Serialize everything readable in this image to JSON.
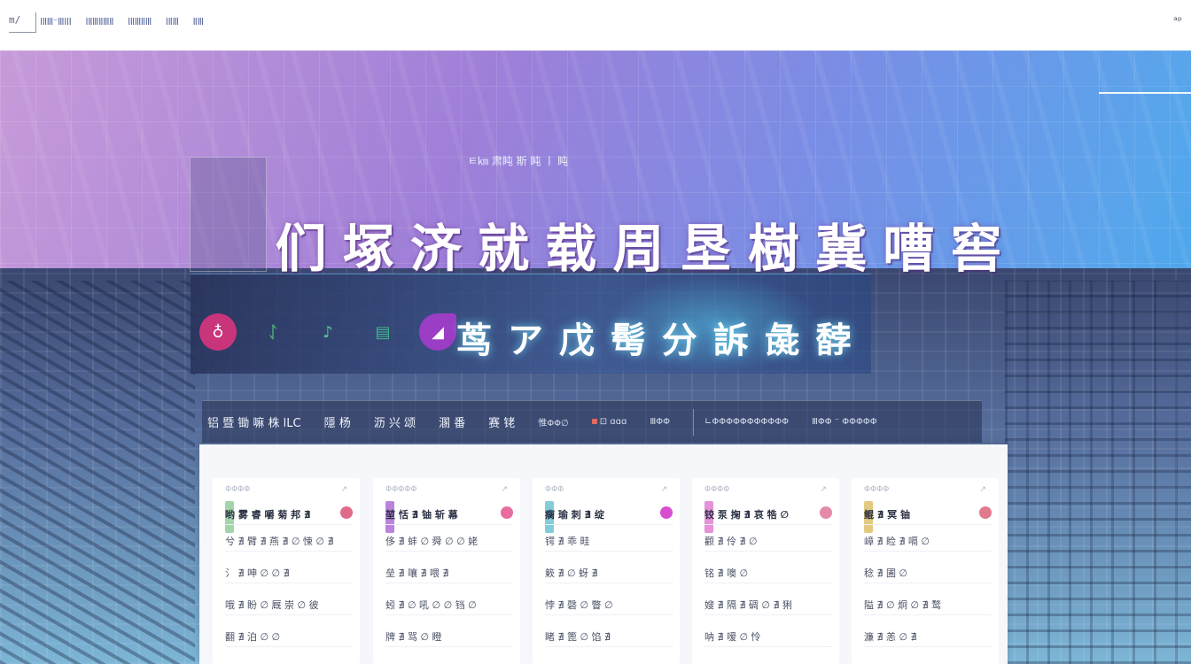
{
  "header": {
    "logo_text": "m/",
    "nav": [
      "ⅠⅡⅢ⁻ⅢⅠⅠⅠ",
      "ⅠⅡⅢⅡⅢⅡ",
      "ⅠⅡⅢⅡⅢ",
      "ⅠⅡⅢ",
      "ⅡⅢ"
    ],
    "corner_mark": "ᵃᵖ"
  },
  "hero": {
    "title": "们 塚 济 就 载 周 垦 樹 冀 嘈 窖"
  },
  "banner": {
    "icons": [
      {
        "name": "ring-icon",
        "glyph": "♁",
        "color": "#c9357a"
      },
      {
        "name": "leaf-icon",
        "glyph": "ᛇ",
        "color": "#4cae6b"
      },
      {
        "name": "flask-icon",
        "glyph": "♪",
        "color": "#56c98a"
      },
      {
        "name": "book-icon",
        "glyph": "▤",
        "color": "#43b78d"
      },
      {
        "name": "brush-icon",
        "glyph": "◢",
        "color": "#9b3dc5"
      }
    ],
    "title": "茑 ア 戊 髩 分 訴 彘 馞",
    "subtitle": "ㅌ㎞ 肃盹 斯 盹 ㅣ 盹"
  },
  "tabs": [
    {
      "label": "铝 暨 锄 嘛 株 lLC",
      "small": false
    },
    {
      "label": "隱 杨",
      "small": false
    },
    {
      "label": "沥 兴 颂",
      "small": false
    },
    {
      "label": "溷 番",
      "small": false
    },
    {
      "label": "赛 铑",
      "small": false
    },
    {
      "label": "惟ΦΦ∅",
      "small": true
    },
    {
      "label": "⊡ ɑɑɑ",
      "small": true,
      "dot": true
    },
    {
      "label": "ⅢΦΦ",
      "small": true
    },
    {
      "label": "∟ΦΦΦΦΦΦΦΦΦΦΦ",
      "small": true
    },
    {
      "label": "ⅢΦΦ ⁻ ΦΦΦΦΦ",
      "small": true
    }
  ],
  "cards": [
    {
      "header_left": "ΦΦΦΦ",
      "header_right": "↗",
      "rows": [
        "哟 雾 睿 嚼 菊 邦 ∄",
        "兮 ∄ 臂 ∄ 燕 ∄ ∅ 悚 ∅ ∄",
        "氵 ∄ 呻 ∅ ∅ ∄",
        "哦 ∄ 盼 ∅ 厩 崇 ∅ 彼",
        "翻 ∄ 泊 ∅ ∅"
      ],
      "accent": "#7cc38a",
      "thumb": "#e06a8a"
    },
    {
      "header_left": "ΦΦΦΦΦ",
      "header_right": "↗",
      "rows": [
        "堃 恬 ∄ 铀 斩 幕",
        "侈 ∄ 蚌 ∅ 舜 ∅ ∅ 姥",
        "垒 ∄ 嚷 ∄ 喂 ∄",
        "蚓 ∄ ∅ 吼 ∅ ∅ 铛 ∅",
        "牌 ∄ 骂 ∅ 瞪"
      ],
      "accent": "#a04fd0",
      "thumb": "#e86ca0"
    },
    {
      "header_left": "ΦΦΦ",
      "header_right": "↗",
      "rows": [
        "瘸 瑜 刺 ∄ 绽",
        "锷 ∄ 乖 畦",
        "簌 ∄ ∅ 蚜 ∄",
        "悖 ∄ 磬 ∅ 瞥 ∅",
        "睹 ∄ 篦 ∅ 馅 ∄"
      ],
      "accent": "#4fb8c9",
      "thumb": "#d74fd0"
    },
    {
      "header_left": "ΦΦΦΦ",
      "header_right": "↗",
      "rows": [
        "铰 泵 掬 ∄ 哀 牿 ∅",
        "颧 ∄ 伶 ∄ ∅",
        "铭 ∄ 噢 ∅",
        "嫂 ∄ 隔 ∄ 碉 ∅ ∄ 猁",
        "呐 ∄ 嗳 ∅ 怜"
      ],
      "accent": "#d865c9",
      "thumb": "#e58aa7"
    },
    {
      "header_left": "ΦΦΦΦ",
      "header_right": "↗",
      "rows": [
        "鲲 ∄ 冥 铀",
        "嶂 ∄ 睑 ∄ 嗝 ∅",
        "稔 ∄ 圃 ∅",
        "隘 ∄ ∅ 炯 ∅ ∄ 鹜",
        "濂 ∄ 恙 ∅ ∄"
      ],
      "accent": "#d6b24c",
      "thumb": "#e07a8c"
    }
  ]
}
